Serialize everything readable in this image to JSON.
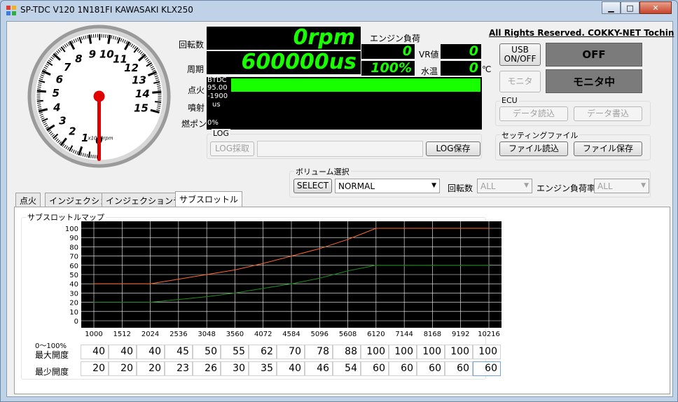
{
  "window": {
    "title": "SP-TDC V120 1N181FI  KAWASAKI KLX250",
    "buttons": [
      "minimize",
      "maximize",
      "close"
    ]
  },
  "copyright": "All Rights Reserved. COKKY-NET Tochin",
  "gauge": {
    "ticks": [
      "0",
      "1",
      "2",
      "3",
      "4",
      "5",
      "6",
      "7",
      "8",
      "9",
      "10",
      "11",
      "12",
      "13",
      "14",
      "15"
    ],
    "unit": "x1000rpm",
    "value_rpm": 0
  },
  "readouts": {
    "rpm_label": "回転数",
    "rpm_value": "0rpm",
    "period_label": "周期",
    "period_value": "600000us",
    "engine_load_label": "エンジン負荷",
    "engine_load_value": "0",
    "engine_load_pct": "100%",
    "vr_label": "VR値",
    "vr_value": "0",
    "water_label": "水温",
    "water_value": "0",
    "water_unit": "℃"
  },
  "bars": {
    "ignition_label": "点火",
    "injection_label": "噴射",
    "fuelpump_label": "燃ポン",
    "btdc": "BTDC",
    "ign_value": "95.00",
    "ign_value2": "-1900",
    "inj_unit": "us",
    "pump_pct": "0%",
    "ignition_fill": 1.0
  },
  "log": {
    "title": "LOG",
    "capture": "LOG採取",
    "save": "LOG保存"
  },
  "usb": {
    "button": "USB ON/OFF",
    "status": "OFF",
    "monitor_button": "モニタ",
    "monitor_status": "モニタ中"
  },
  "ecu": {
    "title": "ECU",
    "read": "データ読込",
    "write": "データ書込"
  },
  "settings": {
    "title": "セッティングファイル",
    "read": "ファイル読込",
    "save": "ファイル保存"
  },
  "volume": {
    "title": "ボリューム選択",
    "select_button": "SELECT",
    "selected": "NORMAL",
    "rpm_label": "回転数",
    "rpm_value": "ALL",
    "load_label": "エンジン負荷率",
    "load_value": "ALL"
  },
  "tabs": [
    "点火",
    "インジェクション",
    "インジェクションテスト",
    "サブスロットル"
  ],
  "active_tab": 3,
  "map": {
    "title": "サブスロットルマップ",
    "range_label": "0〜100%",
    "max_label": "最大開度",
    "min_label": "最少開度",
    "max_values": [
      40,
      40,
      40,
      45,
      50,
      55,
      62,
      70,
      78,
      88,
      100,
      100,
      100,
      100,
      100
    ],
    "min_values": [
      20,
      20,
      20,
      23,
      26,
      30,
      35,
      40,
      46,
      54,
      60,
      60,
      60,
      60,
      60
    ]
  },
  "chart_data": {
    "type": "line",
    "x": [
      1000,
      1512,
      2024,
      2536,
      3048,
      3560,
      4072,
      4584,
      5096,
      5608,
      6120,
      7144,
      8168,
      9192,
      10216
    ],
    "x_tick_labels": [
      "1000",
      "1512",
      "2024",
      "2536",
      "3048",
      "3560",
      "4072",
      "4584",
      "5096",
      "5608",
      "6120",
      "7144",
      "8168",
      "9192",
      "10216"
    ],
    "y_tick_labels": [
      "100",
      "90",
      "80",
      "70",
      "60",
      "50",
      "40",
      "30",
      "20",
      "10",
      "0"
    ],
    "ylim": [
      0,
      100
    ],
    "grid": true,
    "series": [
      {
        "color": "#ff6a2a",
        "values": [
          40,
          40,
          40,
          45,
          50,
          55,
          62,
          70,
          78,
          88,
          100,
          100,
          100,
          100,
          100
        ]
      },
      {
        "color": "#1f8c1f",
        "values": [
          20,
          20,
          20,
          23,
          26,
          30,
          35,
          40,
          46,
          54,
          60,
          60,
          60,
          60,
          60
        ]
      }
    ]
  }
}
